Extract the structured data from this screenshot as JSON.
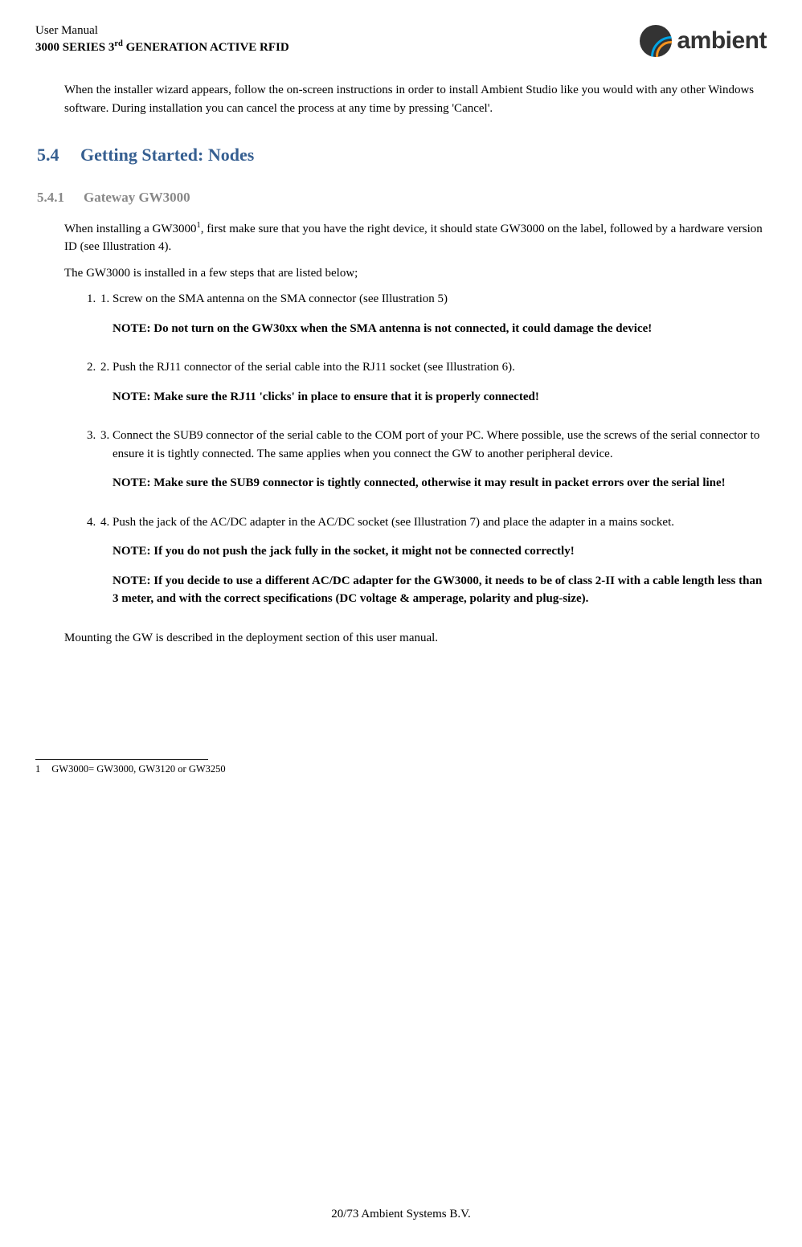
{
  "header": {
    "doc_title": "User Manual",
    "doc_subtitle_pre": "3000 SERIES 3",
    "doc_subtitle_sup": "rd",
    "doc_subtitle_post": " GENERATION ACTIVE RFID",
    "logo_text": "ambient"
  },
  "intro": "When the installer wizard appears, follow the on-screen instructions in order to install Ambient Studio like you would with any other Windows software. During installation you can cancel the process at any time by pressing 'Cancel'.",
  "h2": {
    "num": "5.4",
    "text": "Getting Started: Nodes"
  },
  "h3": {
    "num": "5.4.1",
    "text": "Gateway GW3000"
  },
  "p1_pre": "When installing a GW3000",
  "p1_sup": "1",
  "p1_post": ", first make sure that you have the right device, it should state GW3000 on the label, followed by a hardware version ID (see Illustration 4).",
  "p2": "The GW3000 is installed in a few steps that are listed below;",
  "items": [
    {
      "num": "1.",
      "text": "Screw on the SMA antenna on the SMA connector (see Illustration 5)",
      "notes": [
        "NOTE: Do not turn on the GW30xx when the SMA antenna is not connected, it could damage the device!"
      ]
    },
    {
      "num": "2.",
      "text": "Push the RJ11 connector of the serial cable into the RJ11 socket (see Illustration 6).",
      "notes": [
        "NOTE: Make sure the RJ11 'clicks' in place to ensure that it is properly connected!"
      ]
    },
    {
      "num": "3.",
      "text": "Connect the SUB9 connector of the serial cable to the COM port of your PC. Where possible, use the screws of the serial connector to ensure it is tightly connected. The same applies when you connect the GW to another peripheral device.",
      "notes": [
        "NOTE: Make sure the SUB9 connector is tightly connected, otherwise it may result in packet errors over the serial line!"
      ]
    },
    {
      "num": "4.",
      "text": "Push the jack of the AC/DC adapter in the AC/DC socket (see Illustration 7) and place the adapter in  a mains socket.",
      "notes": [
        "NOTE: If you do not push the jack fully in the socket, it might not be connected correctly!",
        "NOTE: If you decide to use a different AC/DC adapter for the GW3000, it needs to be of class 2-II with a cable length less than 3 meter, and with the correct specifications (DC voltage & amperage, polarity and plug-size)."
      ]
    }
  ],
  "closing": "Mounting the GW is described in the deployment section of this user manual.",
  "footnote": {
    "num": "1",
    "text": "GW3000= GW3000, GW3120 or GW3250"
  },
  "footer": "20/73     Ambient Systems B.V."
}
